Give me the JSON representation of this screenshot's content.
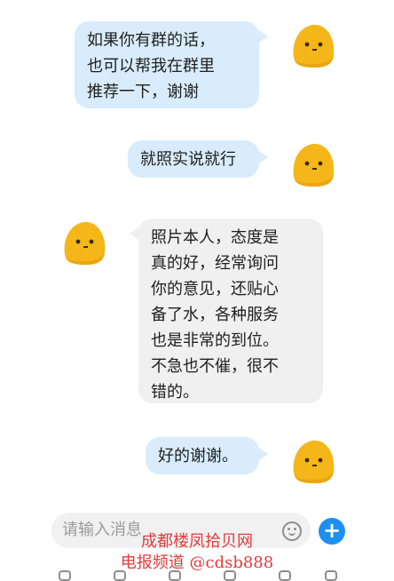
{
  "messages": [
    {
      "side": "out",
      "lines": [
        "如果你有群的话，",
        "也可以帮我在群里",
        "推荐一下，谢谢"
      ]
    },
    {
      "side": "out",
      "lines": [
        "就照实说就行"
      ]
    },
    {
      "side": "in",
      "lines": [
        "照片本人，态度是",
        "真的好，经常询问",
        "你的意见，还贴心",
        "备了水，各种服务",
        "也是非常的到位。",
        "不急也不催，很不",
        "错的。"
      ]
    },
    {
      "side": "out",
      "lines": [
        "好的谢谢。"
      ]
    }
  ],
  "input": {
    "placeholder": "请输入消息"
  },
  "watermark": {
    "line1": "成都楼凤拾贝网",
    "line2": "电报频道 @cdsb888"
  },
  "colors": {
    "outgoing_bubble": "#d8ecfb",
    "incoming_bubble": "#f0f0f0",
    "avatar": "#f5b619",
    "send_button": "#1e8ff0",
    "watermark": "#e23b3b"
  },
  "icons": {
    "avatar": "yellow-blob-avatar-icon",
    "emoji": "emoji-icon",
    "add": "plus-icon"
  }
}
